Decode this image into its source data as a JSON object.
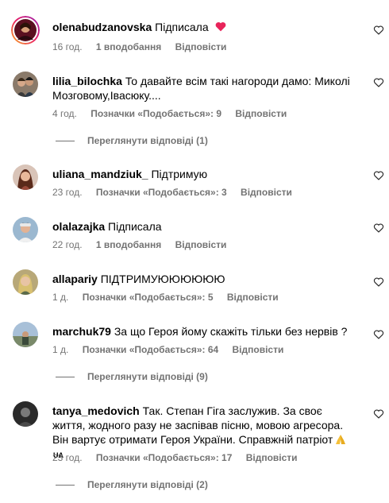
{
  "comments": [
    {
      "username": "olenabudzanovska",
      "text": "Підписала",
      "time": "16 год.",
      "likes": "1 вподобання",
      "reply": "Відповісти"
    },
    {
      "username": "lilia_bilochka",
      "text": "То давайте всім такі нагороди дамо: Миколі Мозговому,Івасюку....",
      "time": "4 год.",
      "likes": "Позначки «Подобається»: 9",
      "reply": "Відповісти",
      "view_replies": "Переглянути відповіді (1)"
    },
    {
      "username": "uliana_mandziuk_",
      "text": "Підтримую",
      "time": "23 год.",
      "likes": "Позначки «Подобається»: 3",
      "reply": "Відповісти"
    },
    {
      "username": "olalazajka",
      "text": "Підписала",
      "time": "22 год.",
      "likes": "1 вподобання",
      "reply": "Відповісти"
    },
    {
      "username": "allapariy",
      "text": "ПІДТРИМУЮЮЮЮЮЮ",
      "time": "1 д.",
      "likes": "Позначки «Подобається»: 5",
      "reply": "Відповісти"
    },
    {
      "username": "marchuk79",
      "text": "За що Героя йому скажіть тільки без нервів ?",
      "time": "1 д.",
      "likes": "Позначки «Подобається»: 64",
      "reply": "Відповісти",
      "view_replies": "Переглянути відповіді (9)"
    },
    {
      "username": "tanya_medovich",
      "text": "Так. Степан Гіга заслужив. За своє життя, жодного разу не заспівав пісню, мовою агресора. Він вартує отримати Героя України. Справжній патріот",
      "flag_text": "UA",
      "time": "23 год.",
      "likes": "Позначки «Подобається»: 17",
      "reply": "Відповісти",
      "view_replies": "Переглянути відповіді (2)"
    }
  ],
  "icons": {
    "like": "heart-outline-icon",
    "emoji_heart": "red-heart-emoji",
    "emoji_pray": "praying-hands-emoji"
  },
  "colors": {
    "text": "#000000",
    "meta": "#737373",
    "emoji_heart": "#e8245a",
    "story_ring": "#d6249f"
  }
}
